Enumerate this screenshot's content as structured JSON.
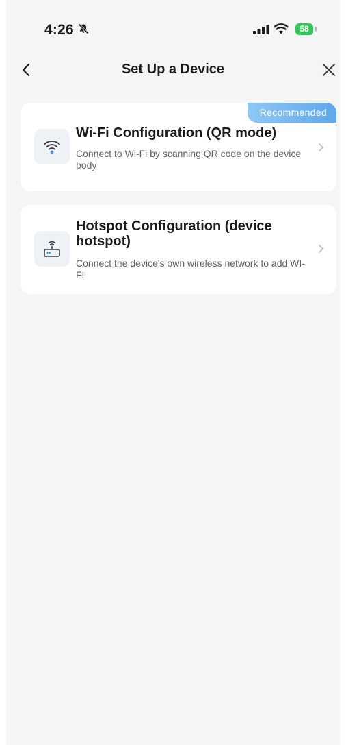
{
  "status_bar": {
    "time": "4:26",
    "battery": "58"
  },
  "nav": {
    "title": "Set Up a Device"
  },
  "options": [
    {
      "title": "Wi-Fi Configuration (QR mode)",
      "description": "Connect to Wi-Fi by scanning QR code on the device body",
      "badge": "Recommended",
      "icon": "wifi-icon"
    },
    {
      "title": "Hotspot Configuration (device hotspot)",
      "description": "Connect the device's own wireless network to add WI-FI",
      "icon": "router-icon"
    }
  ],
  "colors": {
    "accent": "#5ea8ee",
    "battery": "#34c759",
    "background": "#f4f5f7"
  }
}
